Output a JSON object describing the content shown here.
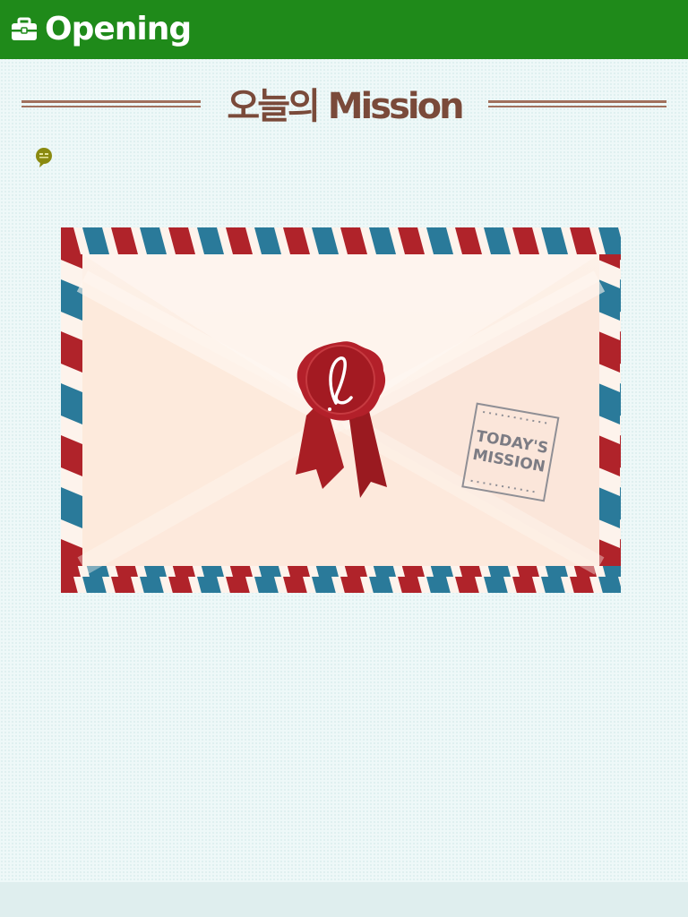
{
  "header": {
    "title": "Opening",
    "icon": "briefcase-icon",
    "background": "#1f8a1a"
  },
  "section": {
    "title": "오늘의 Mission",
    "title_color": "#7a4a3a",
    "rule_color": "#a0705d"
  },
  "badge": {
    "icon": "speech-bubble-icon",
    "color": "#8a8a10"
  },
  "envelope": {
    "stamp_text_line1": "TODAY'S",
    "stamp_text_line2": "MISSION",
    "seal_letter": "l",
    "stripe_red": "#b0232a",
    "stripe_blue": "#2a7a9a",
    "paper_color": "#fdece0"
  }
}
